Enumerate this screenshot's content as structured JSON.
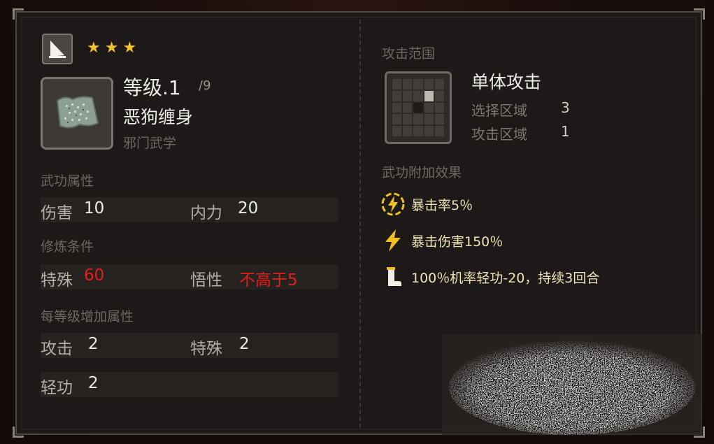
{
  "item": {
    "type_icon": "sail-icon",
    "stars": "★★★",
    "level": "等级.1",
    "level_max": "/9",
    "name": "恶狗缠身",
    "school": "邪门武学",
    "icon": "scroll-icon"
  },
  "attributes": {
    "label": "武功属性",
    "rows": [
      [
        {
          "k": "伤害",
          "v": "10"
        },
        {
          "k": "内力",
          "v": "20"
        }
      ]
    ]
  },
  "requirements": {
    "label": "修炼条件",
    "items": [
      {
        "k": "特殊",
        "v": "60"
      },
      {
        "k": "悟性",
        "v": "不高于5"
      }
    ]
  },
  "per_level": {
    "label": "每等级增加属性",
    "items": [
      {
        "k": "攻击",
        "v": "2"
      },
      {
        "k": "特殊",
        "v": "2"
      },
      {
        "k": "轻功",
        "v": "2"
      }
    ]
  },
  "range": {
    "label": "攻击范围",
    "title": "单体攻击",
    "select_label": "选择区域",
    "select_value": "3",
    "attack_label": "攻击区域",
    "attack_value": "1"
  },
  "effects": {
    "label": "武功附加效果",
    "items": [
      {
        "icon": "lightning-circle-icon",
        "text": "暴击率5％"
      },
      {
        "icon": "lightning-icon",
        "text": "暴击伤害150％"
      },
      {
        "icon": "boot-icon",
        "text": "100％机率轻功-20，持续3回合"
      }
    ]
  },
  "colors": {
    "stars": "#f2c12e",
    "danger": "#e4201c",
    "effect_text": "#efe2b8",
    "effect_icon": "#f0c020"
  }
}
